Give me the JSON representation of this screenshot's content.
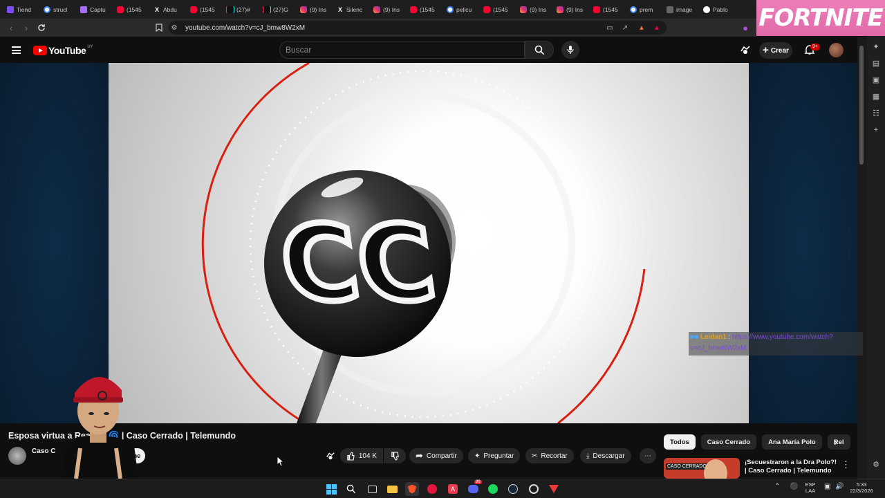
{
  "browser": {
    "tabs": [
      {
        "icon": "obsidian-icon",
        "title": "Tiend"
      },
      {
        "icon": "google-icon",
        "title": "strucl"
      },
      {
        "icon": "capture-icon",
        "title": "Captu"
      },
      {
        "icon": "youtube-icon",
        "title": "(1545"
      },
      {
        "icon": "x-icon",
        "title": "Abdu"
      },
      {
        "icon": "youtube-icon",
        "title": "(1545"
      },
      {
        "icon": "tiktok-icon",
        "title": "(27)#"
      },
      {
        "icon": "tiktok-icon",
        "title": "(27)G"
      },
      {
        "icon": "instagram-icon",
        "title": "(9) Ins"
      },
      {
        "icon": "x-icon",
        "title": "Silenc"
      },
      {
        "icon": "instagram-icon",
        "title": "(9) Ins"
      },
      {
        "icon": "youtube-icon",
        "title": "(1545"
      },
      {
        "icon": "google-icon",
        "title": "pelicu"
      },
      {
        "icon": "youtube-icon",
        "title": "(1545"
      },
      {
        "icon": "instagram-icon",
        "title": "(9) Ins"
      },
      {
        "icon": "instagram-icon",
        "title": "(9) Ins"
      },
      {
        "icon": "youtube-icon",
        "title": "(1545"
      },
      {
        "icon": "google-icon",
        "title": "prem"
      },
      {
        "icon": "image-icon",
        "title": "image"
      },
      {
        "icon": "github-icon",
        "title": "Pablo"
      }
    ],
    "url": "youtube.com/watch?v=cJ_bmw8W2xM",
    "ad_banner": "FORTNITE"
  },
  "youtube": {
    "logo_text": "YouTube",
    "country_code": "UY",
    "search_placeholder": "Buscar",
    "create_label": "Crear",
    "notifications_badge": "9+"
  },
  "chat_overlay": {
    "user": "Leidan1",
    "separator": ":",
    "message": "https://www.youtube.com/watch?v=cJ_bmw8W2xM"
  },
  "video": {
    "title": "Esposa virtua         a Real 💛 🌀 | Caso Cerrado | Telemundo",
    "channel": "Caso C",
    "subscribe_label": "Suscribirme",
    "likes": "104 K",
    "share_label": "Compartir",
    "ask_label": "Preguntar",
    "clip_label": "Recortar",
    "download_label": "Descargar"
  },
  "related": {
    "chips": [
      "Todos",
      "Caso Cerrado",
      "Ana María Polo",
      "Rel"
    ],
    "first_video_title": "¡Secuestraron a la Dra Polo?! | Caso Cerrado | Telemundo",
    "first_video_thumb_label": "CASO CERRADO"
  },
  "taskbar": {
    "lang_top": "ESP",
    "lang_bottom": "LAA",
    "time": "5:33",
    "date": "22/3/2026",
    "spotify_badge": "",
    "discord_badge": "99"
  },
  "colors": {
    "accent": "#ff0000",
    "background": "#0f0f0f",
    "chip_active": "#f1f1f1"
  }
}
